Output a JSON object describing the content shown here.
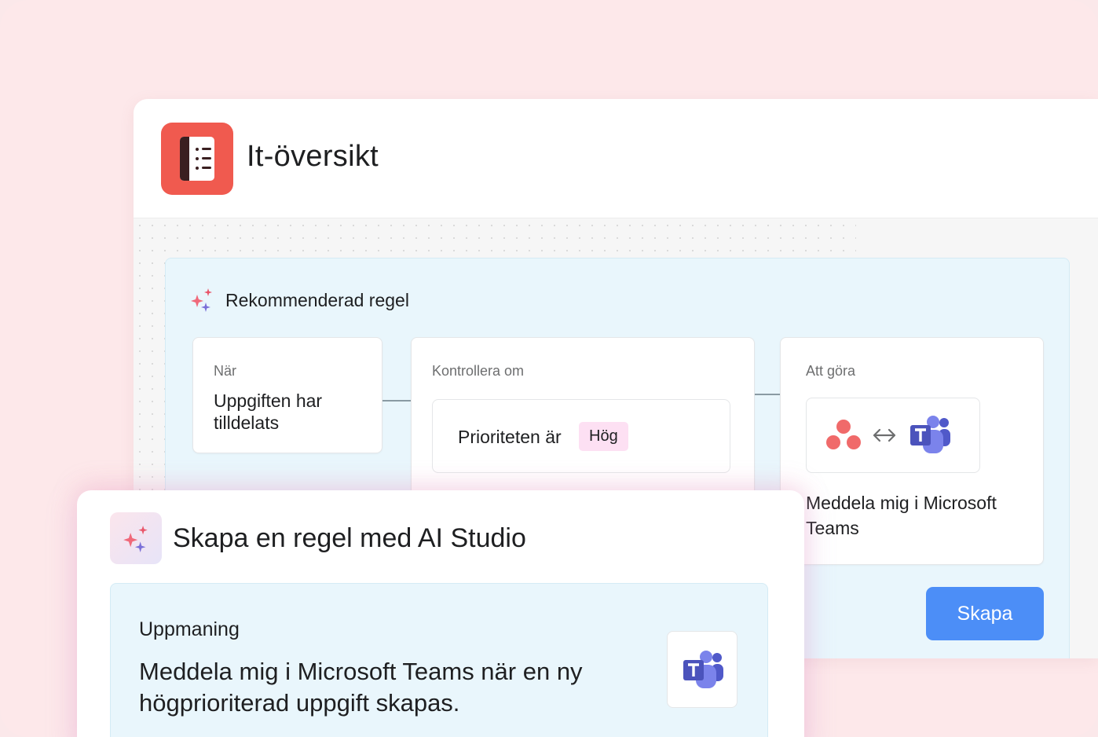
{
  "project": {
    "title": "It-översikt",
    "icon": "notebook-list-icon",
    "accent": "#f05a4f"
  },
  "rule": {
    "heading": "Rekommenderad regel",
    "heading_icon": "sparkle-icon",
    "when": {
      "caption": "När",
      "value": "Uppgiften har tilldelats"
    },
    "check": {
      "caption": "Kontrollera om",
      "condition": "Prioriteten är",
      "pill": "Hög"
    },
    "action": {
      "caption": "Att göra",
      "value": "Meddela mig i Microsoft Teams",
      "apps": [
        "asana-logo-icon",
        "sync-arrows-icon",
        "microsoft-teams-icon"
      ]
    },
    "create_button": "Skapa"
  },
  "ai_studio": {
    "title": "Skapa en regel med AI Studio",
    "icon": "sparkle-icon",
    "prompt_label": "Uppmaning",
    "prompt_text": "Meddela mig i Microsoft Teams när en ny högprioriterad uppgift skapas.",
    "prompt_icon": "microsoft-teams-icon"
  },
  "colors": {
    "background": "#fde8ea",
    "panel": "#e9f6fc",
    "button": "#4c8ef7",
    "pill": "#fde0f3"
  }
}
